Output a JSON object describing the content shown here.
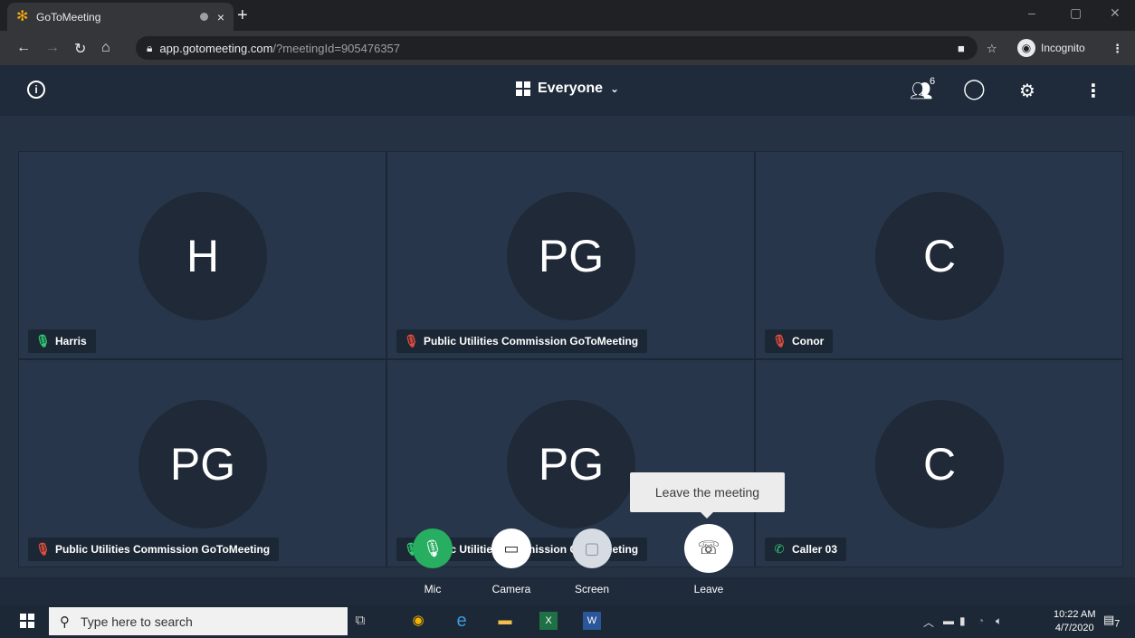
{
  "browser": {
    "tab_title": "GoToMeeting",
    "tab_close": "×",
    "new_tab": "+",
    "url_host": "app.gotomeeting.com",
    "url_path": "/?meetingId=905476357",
    "incognito_label": "Incognito",
    "window_controls": [
      "–",
      "▢",
      "✕"
    ]
  },
  "header": {
    "view_label": "Everyone",
    "participant_count": "6"
  },
  "tiles": [
    {
      "initials": "H",
      "name": "Harris",
      "audio": "mic-on"
    },
    {
      "initials": "PG",
      "name": "Public Utilities Commission GoToMeeting",
      "audio": "mic-off"
    },
    {
      "initials": "C",
      "name": "Conor",
      "audio": "mic-off"
    },
    {
      "initials": "PG",
      "name": "Public Utilities Commission GoToMeeting",
      "audio": "mic-off"
    },
    {
      "initials": "PG",
      "name": "Public Utilities Commission GoToMeeting",
      "audio": "mic-on"
    },
    {
      "initials": "C",
      "name": "Caller 03",
      "audio": "phone"
    }
  ],
  "tooltip": "Leave the meeting",
  "controls": {
    "mic": "Mic",
    "camera": "Camera",
    "screen": "Screen",
    "leave": "Leave"
  },
  "taskbar": {
    "search_placeholder": "Type here to search",
    "time": "10:22 AM",
    "date": "4/7/2020",
    "notification_count": "7"
  },
  "colors": {
    "mic_green": "#27ae60",
    "stage_bg": "#253244",
    "header_bg": "#1f2b3b"
  }
}
